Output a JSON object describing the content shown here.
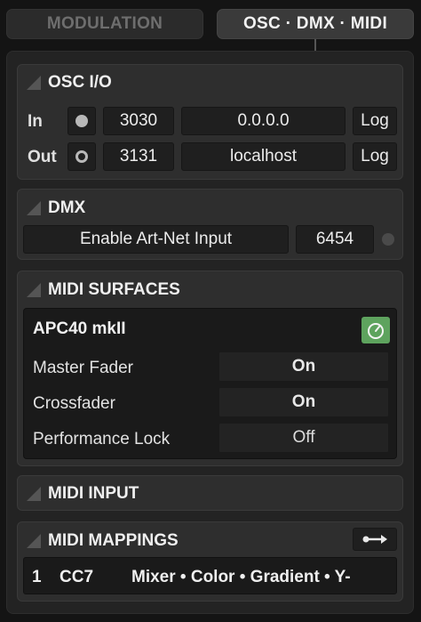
{
  "tabs": [
    {
      "label": "MODULATION",
      "active": false
    },
    {
      "label": "OSC · DMX · MIDI",
      "active": true
    }
  ],
  "osc": {
    "title": "OSC I/O",
    "in": {
      "label": "In",
      "port": "3030",
      "host": "0.0.0.0",
      "log": "Log"
    },
    "out": {
      "label": "Out",
      "port": "3131",
      "host": "localhost",
      "log": "Log"
    }
  },
  "dmx": {
    "title": "DMX",
    "enable_label": "Enable Art-Net Input",
    "port": "6454"
  },
  "midi_surfaces": {
    "title": "MIDI SURFACES",
    "device": {
      "name": "APC40 mkII",
      "power_icon": "power-icon",
      "rows": [
        {
          "label": "Master Fader",
          "value": "On"
        },
        {
          "label": "Crossfader",
          "value": "On"
        },
        {
          "label": "Performance Lock",
          "value": "Off"
        }
      ]
    }
  },
  "midi_input": {
    "title": "MIDI INPUT"
  },
  "midi_mappings": {
    "title": "MIDI MAPPINGS",
    "mapping": {
      "channel": "1",
      "control": "CC7",
      "target": "Mixer • Color • Gradient • Y-"
    }
  },
  "colors": {
    "accent_green": "#5ea35e",
    "background": "#141414",
    "panel": "#2e2e2e"
  }
}
